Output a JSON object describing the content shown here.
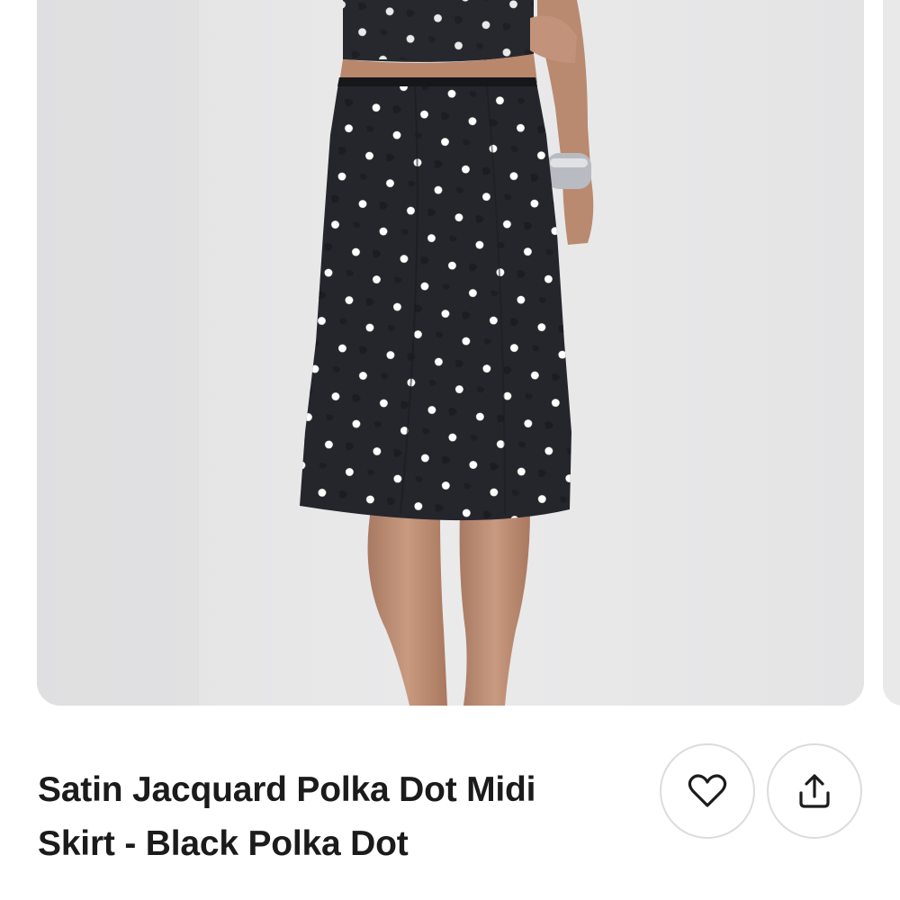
{
  "product": {
    "title": "Satin Jacquard Polka Dot Midi Skirt - Black Polka Dot",
    "image_alt": "Model wearing a black satin jacquard polka dot midi skirt with matching top"
  },
  "actions": {
    "favorite_icon": "heart-outline-icon",
    "share_icon": "share-upload-icon"
  },
  "colors": {
    "skirt": "#24262c",
    "dots": "#ffffff",
    "background": "#e7e7e8",
    "button_border": "#dcdcdc",
    "text": "#1b1b1b"
  }
}
